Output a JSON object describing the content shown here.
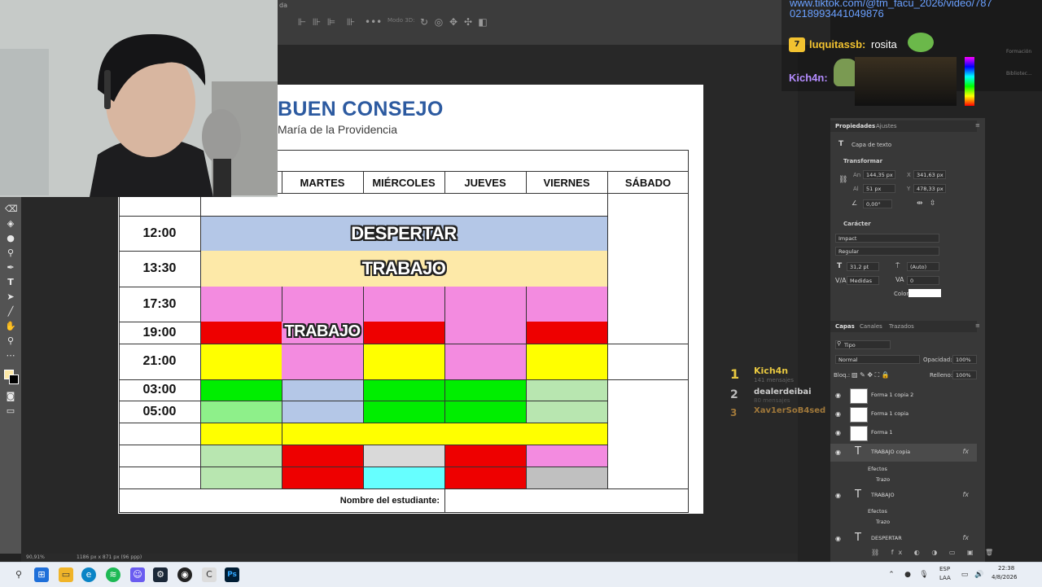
{
  "photoshop": {
    "doc_tab": "da",
    "options": [
      "Modo 3D:"
    ],
    "status_zoom": "90,91%",
    "status_info": "1186 px x 871 px (96 ppp)"
  },
  "document": {
    "logo_title": "BUEN CONSEJO",
    "logo_sub": "María de la Providencia",
    "days": [
      "MARTES",
      "MIÉRCOLES",
      "JUEVES",
      "VIERNES",
      "SÁBADO"
    ],
    "times": [
      "12:00",
      "13:30",
      "17:30",
      "19:00",
      "21:00",
      "03:00",
      "05:00"
    ],
    "banner_despertar": "DESPERTAR",
    "banner_trabajo": "TRABAJO",
    "tuesday_trabajo": "TRABAJO",
    "student_label": "Nombre del estudiante:",
    "colors": {
      "blue": "#b4c7e7",
      "cream": "#fde9a8",
      "pink": "#f38be0",
      "red": "#ee0000",
      "yellow": "#ffff00",
      "green": "#00ee00",
      "lightgreen": "#8ef08a",
      "palegreen": "#b8e6b0",
      "gray": "#d9d9d9",
      "cyan": "#66ffff",
      "darkgray": "#c0c0c0"
    }
  },
  "properties": {
    "tabs": [
      "Propiedades",
      "Ajustes"
    ],
    "layer_type": "Capa de texto",
    "transform_title": "Transformar",
    "w": "144,35 px",
    "x": "341,63 px",
    "h": "51 px",
    "y": "478,33 px",
    "angle": "0,00°",
    "character_title": "Carácter",
    "font": "Impact",
    "style": "Regular",
    "size": "31,2 pt",
    "leading": "(Auto)",
    "kerning": "Medidas",
    "tracking": "0",
    "color_label": "Color"
  },
  "layers": {
    "tabs": [
      "Capas",
      "Canales",
      "Trazados"
    ],
    "filter": "Tipo",
    "blend": "Normal",
    "opacity_label": "Opacidad:",
    "opacity": "100%",
    "lock_label": "Bloq.:",
    "fill_label": "Relleno:",
    "fill": "100%",
    "items": [
      "Forma 1 copia 2",
      "Forma 1 copia",
      "Forma 1",
      "TRABAJO copia",
      "TRABAJO",
      "DESPERTAR"
    ],
    "effects": "Efectos",
    "stroke": "Trazo"
  },
  "chat": {
    "url_line1": "www.tiktok.com/@tm_facu_2026/video/787",
    "url_line2": "0218993441049876",
    "user1": "luquitassb:",
    "msg1": "rosita",
    "user2": "Kich4n:",
    "side_labels": [
      "Formación",
      "Bibliotec..."
    ]
  },
  "leaderboard": [
    {
      "rank": "1",
      "name": "Kich4n",
      "sub": "141 mensajes"
    },
    {
      "rank": "2",
      "name": "dealerdeibai",
      "sub": "80 mensajes"
    },
    {
      "rank": "3",
      "name": "Xav1erSoB4sed",
      "sub": ""
    }
  ],
  "taskbar": {
    "lang1": "ESP",
    "lang2": "LAA",
    "time": "22:38",
    "date": "4/8/2026"
  }
}
